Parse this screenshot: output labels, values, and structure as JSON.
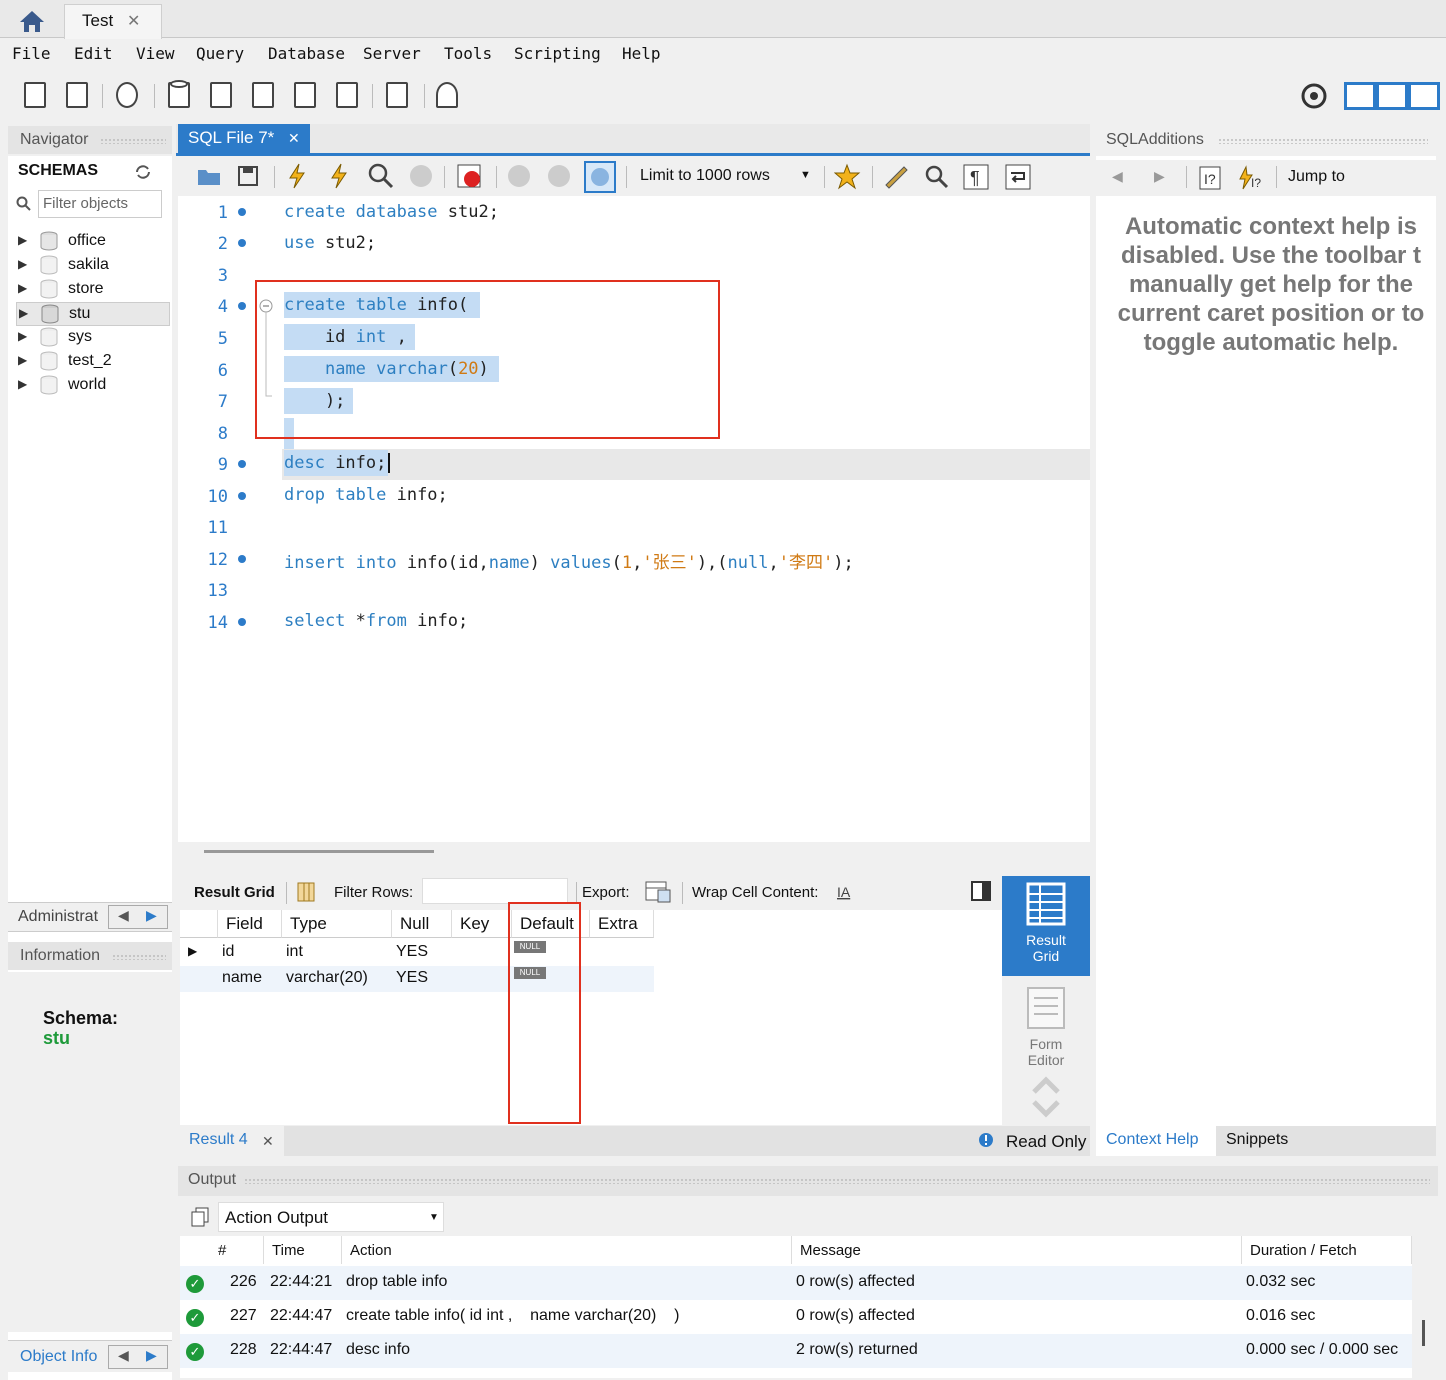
{
  "tabs": {
    "home_icon": "home-icon",
    "test_tab": "Test",
    "close": "✕"
  },
  "menu": [
    "File",
    "Edit",
    "View",
    "Query",
    "Database",
    "Server",
    "Tools",
    "Scripting",
    "Help"
  ],
  "navigator": {
    "title": "Navigator",
    "schemas_label": "SCHEMAS",
    "filter_placeholder": "Filter objects",
    "schemas": [
      "office",
      "sakila",
      "store",
      "stu",
      "sys",
      "test_2",
      "world"
    ],
    "administration_tab": "Administrat",
    "information_title": "Information",
    "schema_label": "Schema:",
    "schema_value": "stu",
    "object_info_tab": "Object Info"
  },
  "editor": {
    "tab_label": "SQL File 7*",
    "limit_label": "Limit to 1000 rows",
    "lines": [
      {
        "n": "1",
        "dot": true
      },
      {
        "n": "2",
        "dot": true
      },
      {
        "n": "3",
        "dot": false
      },
      {
        "n": "4",
        "dot": true
      },
      {
        "n": "5",
        "dot": false
      },
      {
        "n": "6",
        "dot": false
      },
      {
        "n": "7",
        "dot": false
      },
      {
        "n": "8",
        "dot": false
      },
      {
        "n": "9",
        "dot": true
      },
      {
        "n": "10",
        "dot": true
      },
      {
        "n": "11",
        "dot": false
      },
      {
        "n": "12",
        "dot": true
      },
      {
        "n": "13",
        "dot": false
      },
      {
        "n": "14",
        "dot": true
      }
    ],
    "code": {
      "l1a": "create database",
      "l1b": " stu2;",
      "l2a": "use",
      "l2b": " stu2;",
      "l4a": "create table",
      "l4b": " info(",
      "l5a": "    id ",
      "l5b": "int",
      "l5c": " ,",
      "l6a": "    ",
      "l6b": "name",
      "l6c": " ",
      "l6d": "varchar",
      "l6e": "(",
      "l6f": "20",
      "l6g": ")",
      "l7": "    );",
      "l9a": "desc",
      "l9b": " info;",
      "l10a": "drop table",
      "l10b": " info;",
      "l12a": "insert into",
      "l12b": " info(id,",
      "l12c": "name",
      "l12d": ") ",
      "l12e": "values",
      "l12f": "(",
      "l12g": "1",
      "l12h": ",",
      "l12i": "'张三'",
      "l12j": "),(",
      "l12k": "null",
      "l12l": ",",
      "l12m": "'李四'",
      "l12n": ");",
      "l14a": "select",
      "l14b": " *",
      "l14c": "from",
      "l14d": " info;"
    }
  },
  "result": {
    "grid_label": "Result Grid",
    "filter_rows": "Filter Rows:",
    "export": "Export:",
    "wrap": "Wrap Cell Content:",
    "columns": [
      "Field",
      "Type",
      "Null",
      "Key",
      "Default",
      "Extra"
    ],
    "rows": [
      {
        "field": "id",
        "type": "int",
        "null": "YES",
        "key": "",
        "default": "NULL",
        "extra": ""
      },
      {
        "field": "name",
        "type": "varchar(20)",
        "null": "YES",
        "key": "",
        "default": "NULL",
        "extra": ""
      }
    ],
    "side_result_grid": "Result Grid",
    "side_form_editor": "Form Editor",
    "result_tab": "Result 4",
    "read_only": "Read Only"
  },
  "additions": {
    "title": "SQLAdditions",
    "jump_to": "Jump to",
    "help_lines": [
      "Automatic context help is",
      "disabled. Use the toolbar t",
      "manually get help for the",
      "current caret position or to",
      "toggle automatic help."
    ],
    "tab_context": "Context Help",
    "tab_snippets": "Snippets"
  },
  "output": {
    "title": "Output",
    "selector": "Action Output",
    "columns": [
      "#",
      "Time",
      "Action",
      "Message",
      "Duration / Fetch"
    ],
    "rows": [
      {
        "num": "226",
        "time": "22:44:21",
        "action": "drop table info",
        "message": "0 row(s) affected",
        "duration": "0.032 sec"
      },
      {
        "num": "227",
        "time": "22:44:47",
        "action": "create table info( id int ,    name varchar(20)    )",
        "message": "0 row(s) affected",
        "duration": "0.016 sec"
      },
      {
        "num": "228",
        "time": "22:44:47",
        "action": "desc info",
        "message": "2 row(s) returned",
        "duration": "0.000 sec / 0.000 sec"
      }
    ]
  },
  "colors": {
    "accent": "#2c7bc9",
    "keyword": "#2d7fc1",
    "literal": "#d07a14",
    "selection": "#c4dcf4",
    "highlight": "#e0301e",
    "ok": "#1e9a3a"
  }
}
